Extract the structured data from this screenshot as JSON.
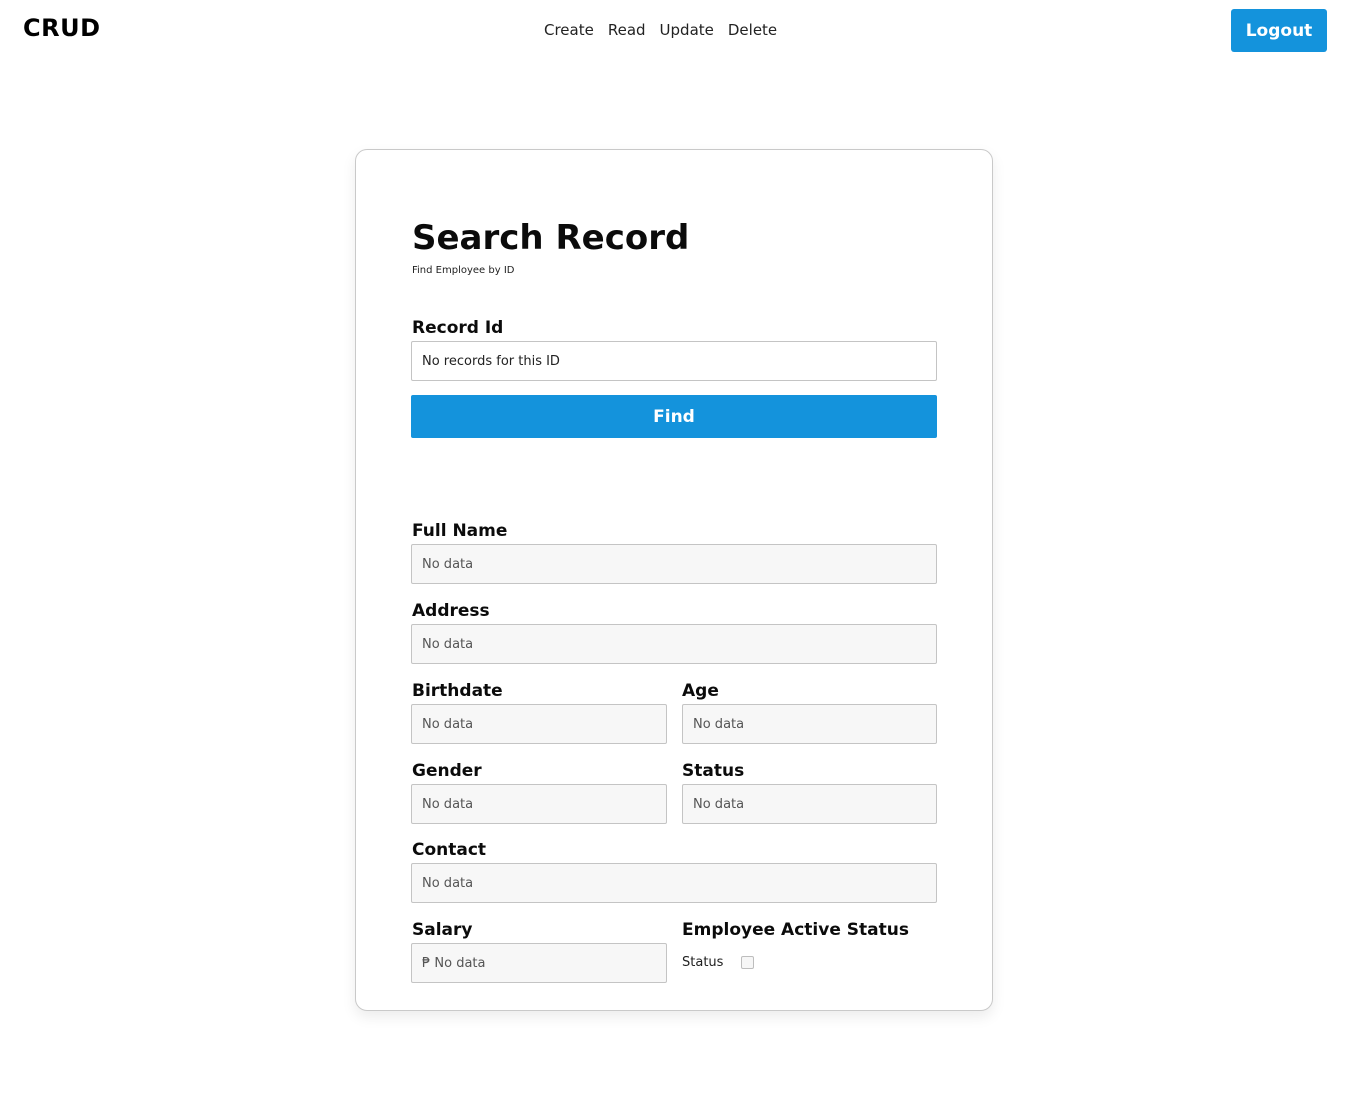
{
  "brand": "CRUD",
  "nav": {
    "links": [
      "Create",
      "Read",
      "Update",
      "Delete"
    ],
    "logout_label": "Logout"
  },
  "search": {
    "title": "Search Record",
    "subtitle": "Find Employee by ID",
    "record_id_label": "Record Id",
    "record_id_value": "No records for this ID",
    "find_label": "Find"
  },
  "details": {
    "full_name": {
      "label": "Full Name",
      "value": "No data"
    },
    "address": {
      "label": "Address",
      "value": "No data"
    },
    "birthdate": {
      "label": "Birthdate",
      "value": "No data"
    },
    "age": {
      "label": "Age",
      "value": "No data"
    },
    "gender": {
      "label": "Gender",
      "value": "No data"
    },
    "status": {
      "label": "Status",
      "value": "No data"
    },
    "contact": {
      "label": "Contact",
      "value": "No data"
    },
    "salary": {
      "label": "Salary",
      "value": "₱ No data"
    },
    "active_status": {
      "label": "Employee Active Status",
      "checkbox_label": "Status",
      "checked": false
    }
  },
  "colors": {
    "accent": "#1493dc",
    "field_bg": "#f7f7f7",
    "border": "#c4c4c4"
  }
}
